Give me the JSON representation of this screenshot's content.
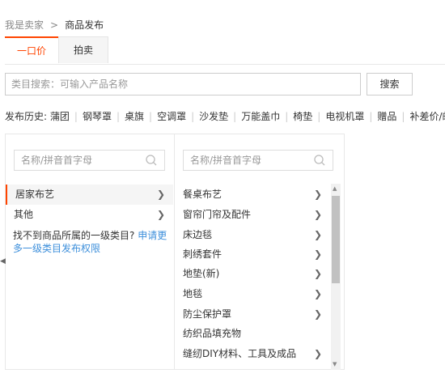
{
  "breadcrumb": {
    "seller_center": "我是卖家",
    "current": "商品发布"
  },
  "tabs": [
    {
      "label": "一口价"
    },
    {
      "label": "拍卖"
    }
  ],
  "category_search": {
    "placeholder": "类目搜索：可输入产品名称",
    "button_label": "搜索"
  },
  "history": {
    "label": "发布历史:",
    "items": [
      "蒲团",
      "钢琴罩",
      "桌旗",
      "空调罩",
      "沙发垫",
      "万能盖巾",
      "椅垫",
      "电视机罩",
      "赠品",
      "补差价/邮费"
    ]
  },
  "level1": {
    "filter_placeholder": "名称/拼音首字母",
    "items": [
      {
        "label": "居家布艺",
        "selected": true
      },
      {
        "label": "其他",
        "selected": false
      }
    ],
    "help_text": "找不到商品所属的一级类目?",
    "help_link": "申请更多一级类目发布权限"
  },
  "level2": {
    "filter_placeholder": "名称/拼音首字母",
    "items": [
      {
        "label": "餐桌布艺",
        "has_children": true
      },
      {
        "label": "窗帘门帘及配件",
        "has_children": true
      },
      {
        "label": "床边毯",
        "has_children": true
      },
      {
        "label": "刺绣套件",
        "has_children": true
      },
      {
        "label": "地垫(新)",
        "has_children": true
      },
      {
        "label": "地毯",
        "has_children": true
      },
      {
        "label": "防尘保护罩",
        "has_children": true
      },
      {
        "label": "纺织品填充物",
        "has_children": false
      },
      {
        "label": "缝纫DIY材料、工具及成品",
        "has_children": true
      }
    ]
  },
  "colors": {
    "accent": "#ff4400",
    "link": "#3d8fdb",
    "border": "#e8e8e8"
  },
  "icons": {
    "chevron": "chevron-right-icon",
    "search": "search-icon"
  }
}
